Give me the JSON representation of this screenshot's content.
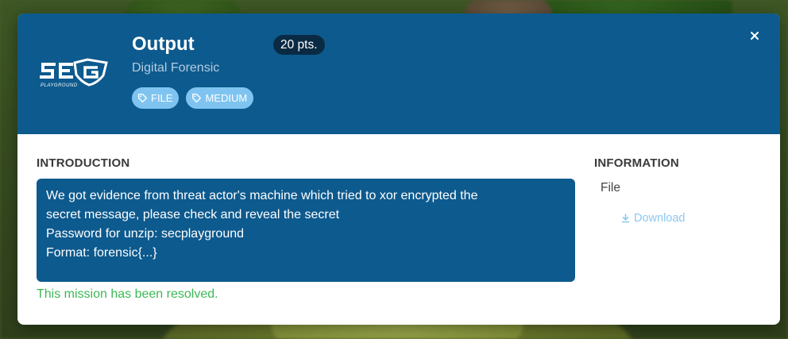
{
  "mission": {
    "title": "Output",
    "points": "20 pts.",
    "category": "Digital Forensic",
    "tags": [
      {
        "label": "FILE",
        "icon": "tag-icon"
      },
      {
        "label": "MEDIUM",
        "icon": "tag-icon"
      }
    ],
    "logo": {
      "text": "SEG",
      "sub_text": "PLAYGROUND"
    }
  },
  "introduction": {
    "heading": "INTRODUCTION",
    "lines": [
      "We got evidence from threat actor's machine which tried to xor encrypted the",
      "secret message, please check and reveal the secret",
      "Password for unzip: secplayground",
      "Format: forensic{...}"
    ]
  },
  "status": {
    "message": "This mission has been resolved."
  },
  "information": {
    "heading": "INFORMATION",
    "file_label": "File",
    "download_label": "Download",
    "download_icon": "download-icon"
  },
  "colors": {
    "header_bg": "#0d5a8e",
    "points_badge_bg": "#0a2a44",
    "tag_bg": "#7fc4f0",
    "resolved_text": "#3cb855",
    "download_link": "#8cc8f0"
  },
  "close_icon": "close-icon"
}
